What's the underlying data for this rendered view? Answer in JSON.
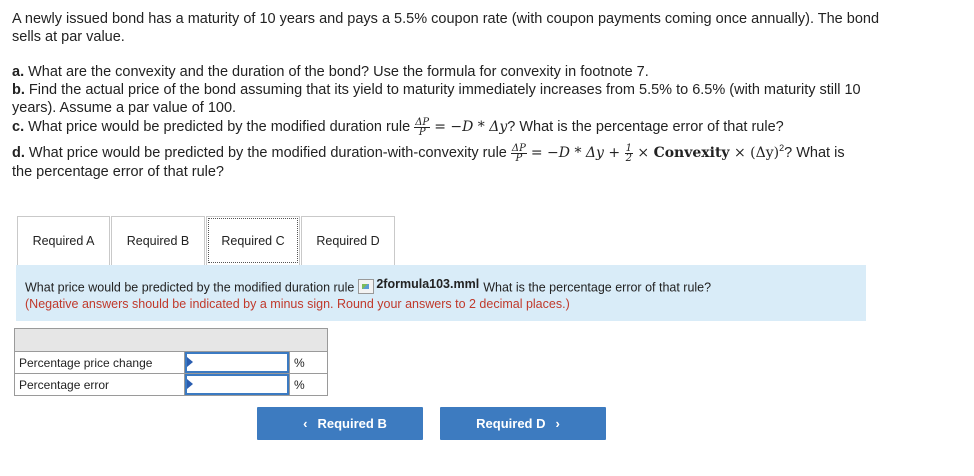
{
  "stem": {
    "line1": "A newly issued bond has a maturity of 10 years and pays a 5.5% coupon rate (with coupon payments coming once annually). The bond",
    "line2": "sells at par value."
  },
  "parts": {
    "a_label": "a.",
    "a_text": " What are the convexity and the duration of the bond? Use the formula for convexity in footnote 7.",
    "b_label": "b.",
    "b_text_1": " Find the actual price of the bond assuming that its yield to maturity immediately increases from 5.5% to 6.5% (with maturity still 10",
    "b_text_2": "years). Assume a par value of 100.",
    "c_label": "c.",
    "c_text_pre": " What price would be predicted by the modified duration rule ",
    "c_formula": "= −D * Δy",
    "c_text_post": "? What is the percentage error of that rule?",
    "d_label": "d.",
    "d_text_pre": " What price would be predicted by the modified duration-with-convexity rule ",
    "d_formula_1": "= −D * Δy + ",
    "d_formula_2": " × ",
    "d_convexity": "Convexity",
    "d_formula_3": " × (Δy)",
    "d_exp": "2",
    "d_text_post": "? What is",
    "d_text_2": "the percentage error of that rule?",
    "frac_num": "ΔP",
    "frac_den": "P",
    "half_num": "1",
    "half_den": "2"
  },
  "tabs": [
    {
      "label": "Required A",
      "active": false
    },
    {
      "label": "Required B",
      "active": false
    },
    {
      "label": "Required C",
      "active": true
    },
    {
      "label": "Required D",
      "active": false
    }
  ],
  "question": {
    "text_pre": "What price would be predicted by the modified duration rule",
    "image_alt": "2formula103.mml",
    "text_post": "What is the percentage error of that rule?",
    "instruction": "(Negative answers should be indicated by a minus sign. Round your answers to 2 decimal places.)"
  },
  "answer_table": {
    "rows": [
      {
        "label": "Percentage price change",
        "value": "",
        "unit": "%"
      },
      {
        "label": "Percentage error",
        "value": "",
        "unit": "%"
      }
    ]
  },
  "nav": {
    "prev_label": "Required B",
    "next_label": "Required D",
    "color": "#3d7bc0"
  }
}
